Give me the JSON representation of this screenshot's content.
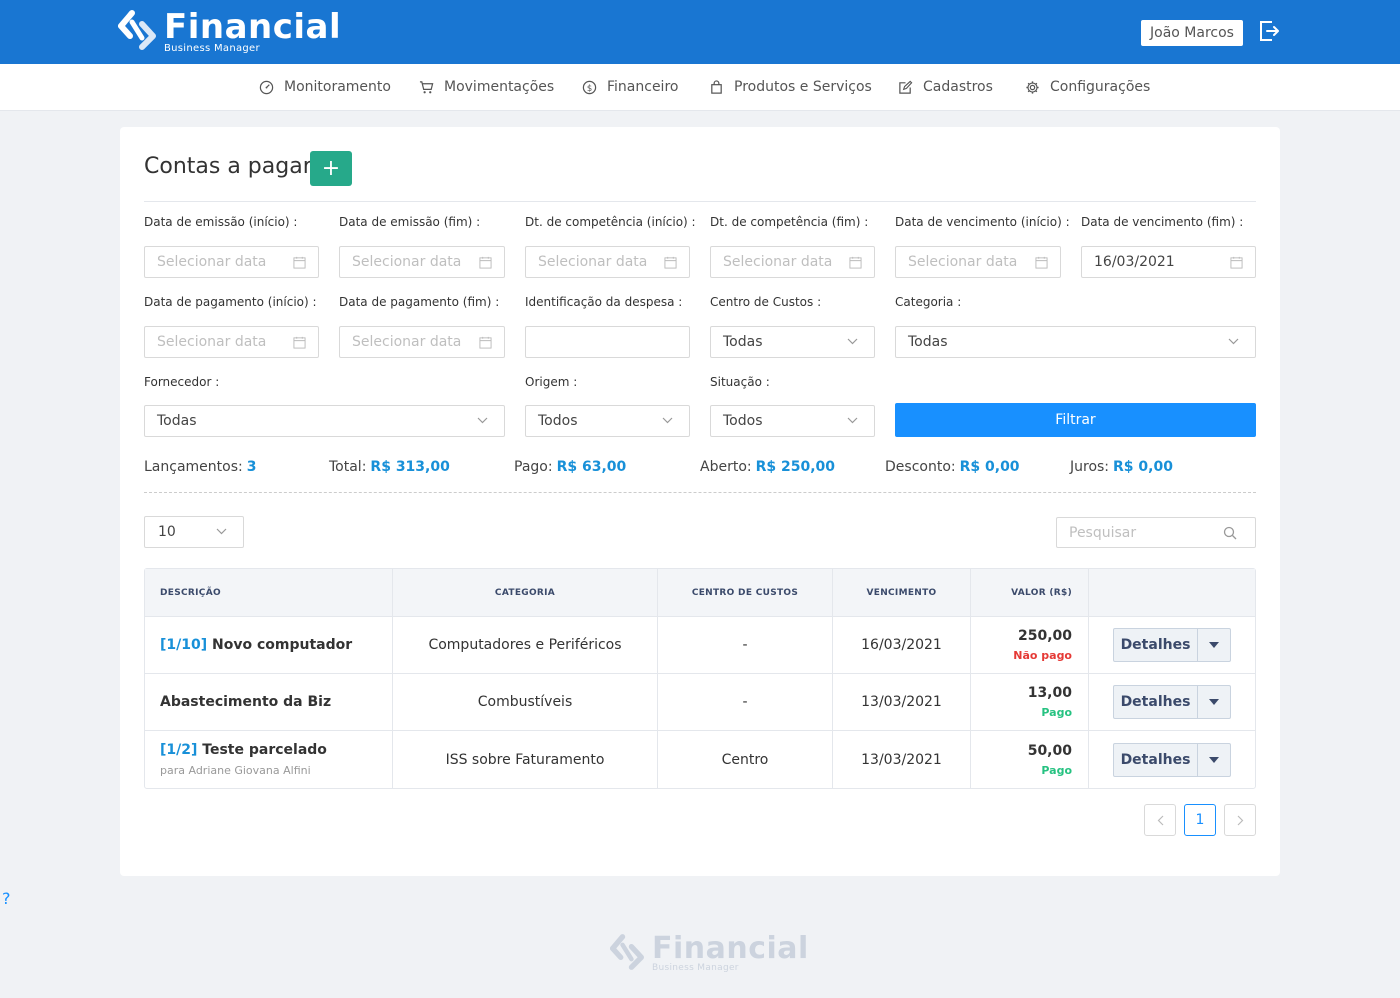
{
  "app": {
    "logo_title": "Financial",
    "logo_subtitle": "Business Manager",
    "user_name": "João Marcos"
  },
  "nav": {
    "items": [
      {
        "label": "Monitoramento",
        "icon": "dashboard-icon"
      },
      {
        "label": "Movimentações",
        "icon": "cart-icon"
      },
      {
        "label": "Financeiro",
        "icon": "dollar-icon"
      },
      {
        "label": "Produtos e Serviços",
        "icon": "bag-icon"
      },
      {
        "label": "Cadastros",
        "icon": "edit-icon"
      },
      {
        "label": "Configurações",
        "icon": "gear-icon"
      }
    ]
  },
  "page": {
    "title": "Contas a pagar",
    "add_label": "+"
  },
  "filters": {
    "emissao_inicio": {
      "label": "Data de emissão (início) :",
      "placeholder": "Selecionar data",
      "value": ""
    },
    "emissao_fim": {
      "label": "Data de emissão (fim) :",
      "placeholder": "Selecionar data",
      "value": ""
    },
    "competencia_inicio": {
      "label": "Dt. de competência (início) :",
      "placeholder": "Selecionar data",
      "value": ""
    },
    "competencia_fim": {
      "label": "Dt. de competência (fim) :",
      "placeholder": "Selecionar data",
      "value": ""
    },
    "vencimento_inicio": {
      "label": "Data de vencimento (início) :",
      "placeholder": "Selecionar data",
      "value": ""
    },
    "vencimento_fim": {
      "label": "Data de vencimento (fim) :",
      "placeholder": "Selecionar data",
      "value": "16/03/2021"
    },
    "pagamento_inicio": {
      "label": "Data de pagamento (início) :",
      "placeholder": "Selecionar data",
      "value": ""
    },
    "pagamento_fim": {
      "label": "Data de pagamento (fim) :",
      "placeholder": "Selecionar data",
      "value": ""
    },
    "identificacao": {
      "label": "Identificação da despesa :",
      "value": ""
    },
    "centro_custos": {
      "label": "Centro de Custos :",
      "value": "Todas"
    },
    "categoria": {
      "label": "Categoria :",
      "value": "Todas"
    },
    "fornecedor": {
      "label": "Fornecedor :",
      "value": "Todas"
    },
    "origem": {
      "label": "Origem :",
      "value": "Todos"
    },
    "situacao": {
      "label": "Situação :",
      "value": "Todos"
    },
    "filter_button": "Filtrar"
  },
  "summary": {
    "lancamentos": {
      "label": "Lançamentos:",
      "value": "3"
    },
    "total": {
      "label": "Total:",
      "value": "R$ 313,00"
    },
    "pago": {
      "label": "Pago:",
      "value": "R$ 63,00"
    },
    "aberto": {
      "label": "Aberto:",
      "value": "R$ 250,00"
    },
    "desconto": {
      "label": "Desconto:",
      "value": "R$ 0,00"
    },
    "juros": {
      "label": "Juros:",
      "value": "R$ 0,00"
    }
  },
  "list": {
    "page_size": "10",
    "search_placeholder": "Pesquisar"
  },
  "table": {
    "headers": [
      "DESCRIÇÃO",
      "CATEGORIA",
      "CENTRO DE CUSTOS",
      "VENCIMENTO",
      "VALOR (R$)"
    ],
    "rows": [
      {
        "tag": "[1/10]",
        "description": " Novo computador",
        "sub": "",
        "category": "Computadores e Periféricos",
        "cost_center": "-",
        "due": "16/03/2021",
        "value": "250,00",
        "status": "Não pago",
        "action": "Detalhes"
      },
      {
        "tag": "",
        "description": "Abastecimento da Biz",
        "sub": "",
        "category": "Combustíveis",
        "cost_center": "-",
        "due": "13/03/2021",
        "value": "13,00",
        "status": "Pago",
        "action": "Detalhes"
      },
      {
        "tag": "[1/2]",
        "description": " Teste parcelado",
        "sub": "para Adriane Giovana Alfini",
        "category": "ISS sobre Faturamento",
        "cost_center": "Centro",
        "due": "13/03/2021",
        "value": "50,00",
        "status": "Pago",
        "action": "Detalhes"
      }
    ]
  },
  "pagination": {
    "current": "1"
  },
  "help": "?",
  "colors": {
    "brand": "#1976d2",
    "accent": "#1890ff",
    "add_button": "#26a98a",
    "paid": "#26c281",
    "unpaid": "#e53935"
  }
}
